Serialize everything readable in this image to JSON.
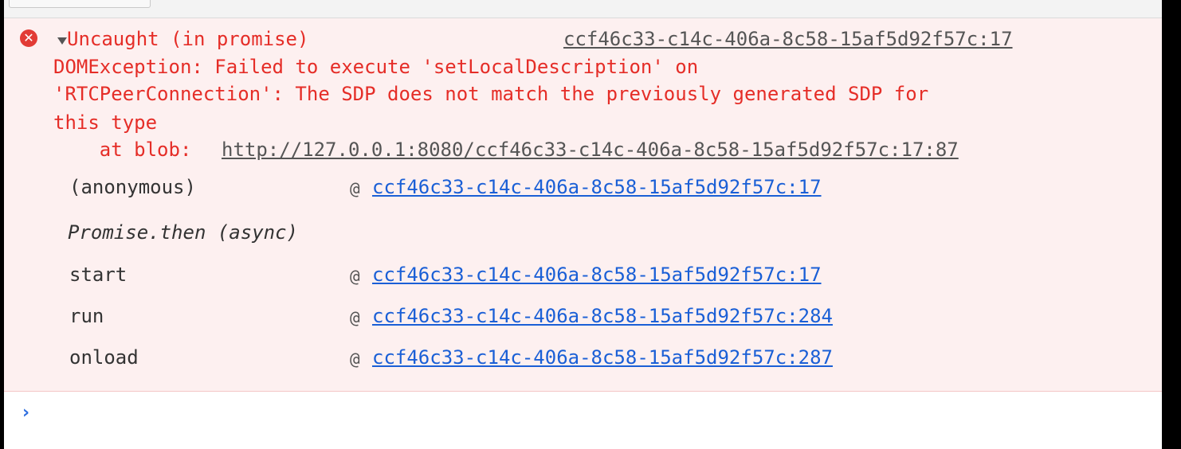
{
  "error": {
    "title": "Uncaught (in promise)",
    "source": "ccf46c33-c14c-406a-8c58-15af5d92f57c:17",
    "message_lines": [
      "DOMException: Failed to execute 'setLocalDescription' on",
      "'RTCPeerConnection': The SDP does not match the previously generated SDP for",
      "this type"
    ],
    "at_prefix": "    at blob:",
    "at_link": "http://127.0.0.1:8080/ccf46c33-c14c-406a-8c58-15af5d92f57c:17:87"
  },
  "stack": [
    {
      "fn": "(anonymous)",
      "at": "@",
      "loc": "ccf46c33-c14c-406a-8c58-15af5d92f57c:17"
    },
    {
      "fn": "Promise.then (async)"
    },
    {
      "fn": "start",
      "at": "@",
      "loc": "ccf46c33-c14c-406a-8c58-15af5d92f57c:17"
    },
    {
      "fn": "run",
      "at": "@",
      "loc": "ccf46c33-c14c-406a-8c58-15af5d92f57c:284"
    },
    {
      "fn": "onload",
      "at": "@",
      "loc": "ccf46c33-c14c-406a-8c58-15af5d92f57c:287"
    }
  ],
  "prompt": {
    "caret": "›",
    "icon": "chevron-right-icon"
  },
  "icons": {
    "error": "error-circle-icon",
    "expand": "expand-triangle-icon"
  },
  "colors": {
    "error_text": "#e52d27",
    "link": "#1a5fd6",
    "error_bg": "#fdf0f0"
  }
}
